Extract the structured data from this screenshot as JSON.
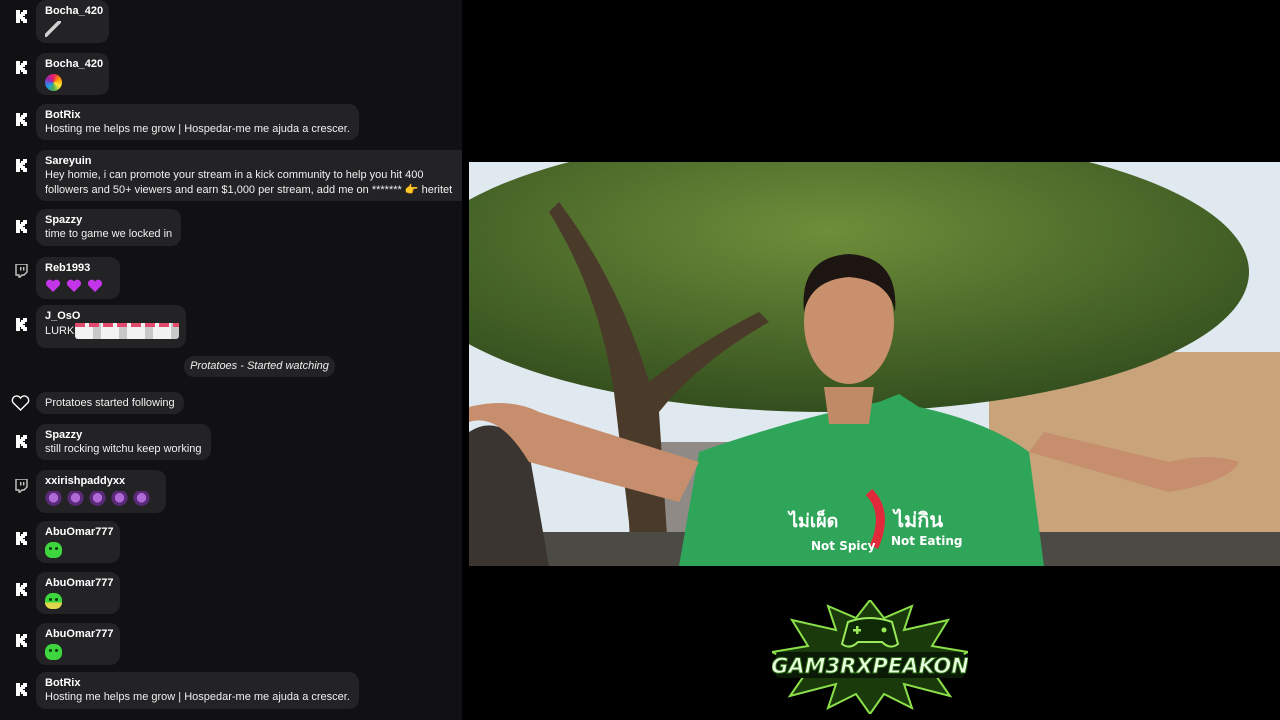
{
  "chat": {
    "messages": [
      {
        "platform": "kick",
        "user": "Bocha_420",
        "emotes": [
          "stick"
        ]
      },
      {
        "platform": "kick",
        "user": "Bocha_420",
        "emotes": [
          "flowers"
        ]
      },
      {
        "platform": "kick",
        "user": "BotRix",
        "text": "Hosting me helps me grow | Hospedar-me me ajuda a crescer."
      },
      {
        "platform": "kick",
        "user": "Sareyuin",
        "text": "Hey homie, i can promote your stream in a kick community to help you hit 400 followers and 50+ viewers and earn $1,000 per stream, add me on ******* 👉 heritet"
      },
      {
        "platform": "kick",
        "user": "Spazzy",
        "text": "time to game we locked in"
      },
      {
        "platform": "twitch",
        "user": "Reb1993",
        "emotes": [
          "heart",
          "heart",
          "heart"
        ]
      },
      {
        "platform": "kick",
        "user": "J_OsO",
        "text": "LURK"
      },
      {
        "platform": "kick",
        "user": "Spazzy",
        "text": "still rocking witchu keep working"
      },
      {
        "platform": "twitch",
        "user": "xxirishpaddyxx",
        "emotes": [
          "dance",
          "dance",
          "dance",
          "dance",
          "dance"
        ]
      },
      {
        "platform": "kick",
        "user": "AbuOmar777",
        "emotes": [
          "blob"
        ]
      },
      {
        "platform": "kick",
        "user": "AbuOmar777",
        "emotes": [
          "blob-yellow"
        ]
      },
      {
        "platform": "kick",
        "user": "AbuOmar777",
        "emotes": [
          "blob"
        ]
      },
      {
        "platform": "kick",
        "user": "BotRix",
        "text": "Hosting me helps me grow | Hospedar-me me ajuda a crescer."
      }
    ],
    "system_notice": "Protatoes - Started watching",
    "follow_notice": "Protatoes started following"
  },
  "video": {
    "shirt_text_thai_left": "ไม่เผ็ด",
    "shirt_text_thai_right": "ไม่กิน",
    "shirt_text_left": "Not Spicy",
    "shirt_text_right": "Not Eating"
  },
  "logo": {
    "text": "GAM3RXPEAKON",
    "colors": {
      "primary": "#7fd83a",
      "outline": "#0b1a06"
    }
  },
  "colors": {
    "kick_green": "#53fc18",
    "bubble": "#232326",
    "chat_bg": "#111113"
  }
}
